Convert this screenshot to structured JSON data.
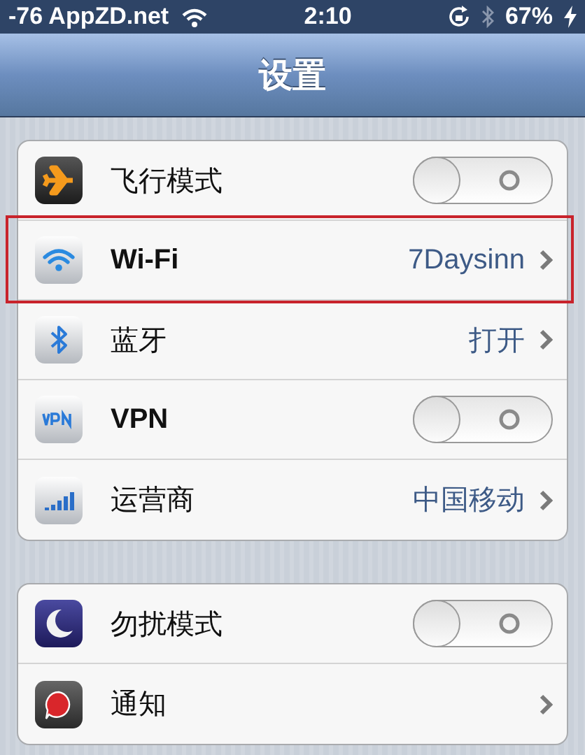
{
  "status_bar": {
    "carrier": "-76 AppZD.net",
    "time": "2:10",
    "battery": "67%"
  },
  "nav_bar": {
    "title": "设置"
  },
  "groups": [
    {
      "rows": [
        {
          "kind": "toggle",
          "label": "飞行模式",
          "on": false,
          "highlighted": false
        },
        {
          "kind": "link",
          "label": "Wi-Fi",
          "value": "7Daysinn",
          "highlighted": true
        },
        {
          "kind": "link",
          "label": "蓝牙",
          "value": "打开",
          "highlighted": false
        },
        {
          "kind": "toggle",
          "label": "VPN",
          "on": false,
          "highlighted": false
        },
        {
          "kind": "link",
          "label": "运营商",
          "value": "中国移动",
          "highlighted": false
        }
      ]
    },
    {
      "rows": [
        {
          "kind": "toggle",
          "label": "勿扰模式",
          "on": false,
          "highlighted": false
        },
        {
          "kind": "link",
          "label": "通知",
          "highlighted": false
        }
      ]
    }
  ]
}
